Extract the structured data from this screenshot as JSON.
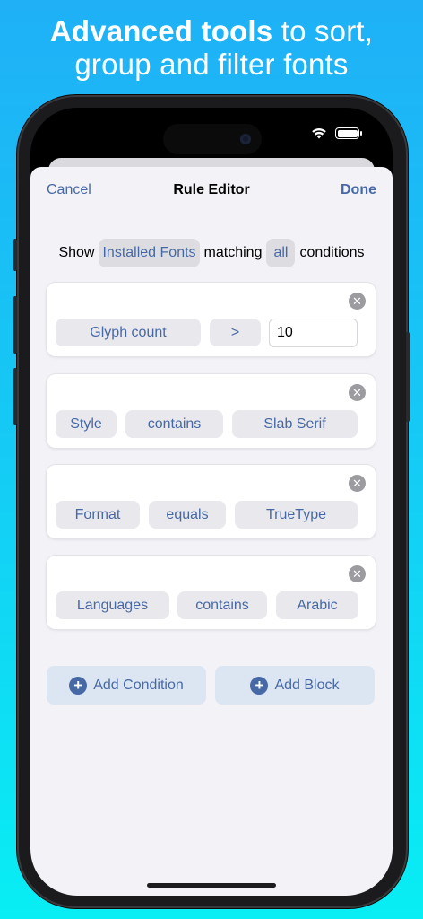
{
  "headline": {
    "bold": "Advanced tools",
    "line1_rest": " to sort,",
    "line2": "group and filter fonts"
  },
  "status_bar": {
    "wifi_icon": "wifi-icon",
    "battery_icon": "battery-icon"
  },
  "nav": {
    "cancel": "Cancel",
    "title": "Rule Editor",
    "done": "Done"
  },
  "match": {
    "show": "Show",
    "source": "Installed Fonts",
    "matching": "matching",
    "quantifier": "all",
    "conditions": "conditions"
  },
  "rules": [
    {
      "field": "Glyph count",
      "operator": ">",
      "value": "10"
    },
    {
      "field": "Style",
      "operator": "contains",
      "value": "Slab Serif"
    },
    {
      "field": "Format",
      "operator": "equals",
      "value": "TrueType"
    },
    {
      "field": "Languages",
      "operator": "contains",
      "value": "Arabic"
    }
  ],
  "actions": {
    "add_condition": "Add Condition",
    "add_block": "Add Block"
  },
  "colors": {
    "accent": "#4669a6",
    "sheet_bg": "#f2f2f7",
    "background_top": "#1fb0f6",
    "background_bottom": "#08eef4"
  }
}
